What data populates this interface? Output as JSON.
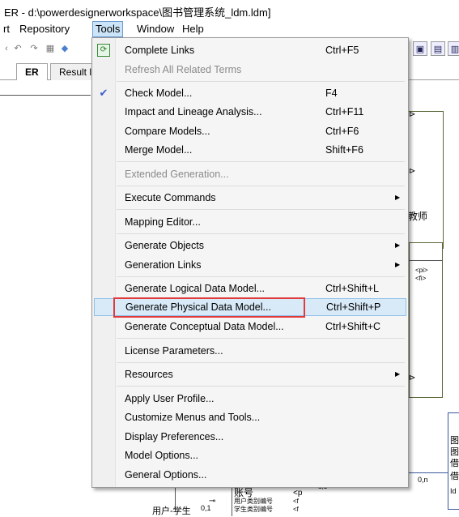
{
  "window": {
    "title": "ER - d:\\powerdesignerworkspace\\图书管理系统_ldm.ldm]"
  },
  "menubar": {
    "items": [
      "rt",
      "Repository",
      "Tools",
      "Window",
      "Help"
    ],
    "active": "Tools"
  },
  "tabs": [
    {
      "label": "ER",
      "active": true
    },
    {
      "label": "Result l",
      "active": false
    }
  ],
  "diagram": {
    "labels": {
      "teacher": "教师",
      "pi": "<pi>",
      "fi": "<fi>",
      "account": "账号",
      "pi_short": "<p",
      "user_student": "用户-学生",
      "rel_card": "0,1",
      "rel_card2": "0,n",
      "rel_card3": "1,1",
      "attr1": "用户类别编号",
      "attr2": "学生类别编号",
      "f1": "<f",
      "f2": "<f",
      "side1": "图",
      "side2": "图",
      "side3": "借",
      "side4": "借",
      "side5": "Id"
    }
  },
  "tools_menu": {
    "items": [
      {
        "type": "item",
        "label": "Complete Links",
        "shortcut": "Ctrl+F5",
        "icon": "complete-links-icon"
      },
      {
        "type": "item",
        "label": "Refresh All Related Terms",
        "shortcut": "",
        "disabled": true
      },
      {
        "type": "sep"
      },
      {
        "type": "item",
        "label": "Check Model...",
        "shortcut": "F4",
        "icon": "check-model-icon"
      },
      {
        "type": "item",
        "label": "Impact and Lineage Analysis...",
        "shortcut": "Ctrl+F11"
      },
      {
        "type": "item",
        "label": "Compare Models...",
        "shortcut": "Ctrl+F6"
      },
      {
        "type": "item",
        "label": "Merge Model...",
        "shortcut": "Shift+F6"
      },
      {
        "type": "sep"
      },
      {
        "type": "item",
        "label": "Extended Generation...",
        "shortcut": "",
        "disabled": true
      },
      {
        "type": "sep"
      },
      {
        "type": "item",
        "label": "Execute Commands",
        "shortcut": "",
        "submenu": true
      },
      {
        "type": "sep"
      },
      {
        "type": "item",
        "label": "Mapping Editor...",
        "shortcut": ""
      },
      {
        "type": "sep"
      },
      {
        "type": "item",
        "label": "Generate Objects",
        "shortcut": "",
        "submenu": true
      },
      {
        "type": "item",
        "label": "Generation Links",
        "shortcut": "",
        "submenu": true
      },
      {
        "type": "sep"
      },
      {
        "type": "item",
        "label": "Generate Logical Data Model...",
        "shortcut": "Ctrl+Shift+L"
      },
      {
        "type": "item",
        "label": "Generate Physical Data Model...",
        "shortcut": "Ctrl+Shift+P",
        "highlighted": true
      },
      {
        "type": "item",
        "label": "Generate Conceptual Data Model...",
        "shortcut": "Ctrl+Shift+C"
      },
      {
        "type": "sep"
      },
      {
        "type": "item",
        "label": "License Parameters...",
        "shortcut": ""
      },
      {
        "type": "sep"
      },
      {
        "type": "item",
        "label": "Resources",
        "shortcut": "",
        "submenu": true
      },
      {
        "type": "sep"
      },
      {
        "type": "item",
        "label": "Apply User Profile...",
        "shortcut": ""
      },
      {
        "type": "item",
        "label": "Customize Menus and Tools...",
        "shortcut": ""
      },
      {
        "type": "item",
        "label": "Display Preferences...",
        "shortcut": ""
      },
      {
        "type": "item",
        "label": "Model Options...",
        "shortcut": ""
      },
      {
        "type": "item",
        "label": "General Options...",
        "shortcut": ""
      }
    ]
  },
  "colors": {
    "highlight_bg": "#d8e9f8",
    "highlight_border": "#90c0ea",
    "annotation_red": "#e23b3b"
  }
}
